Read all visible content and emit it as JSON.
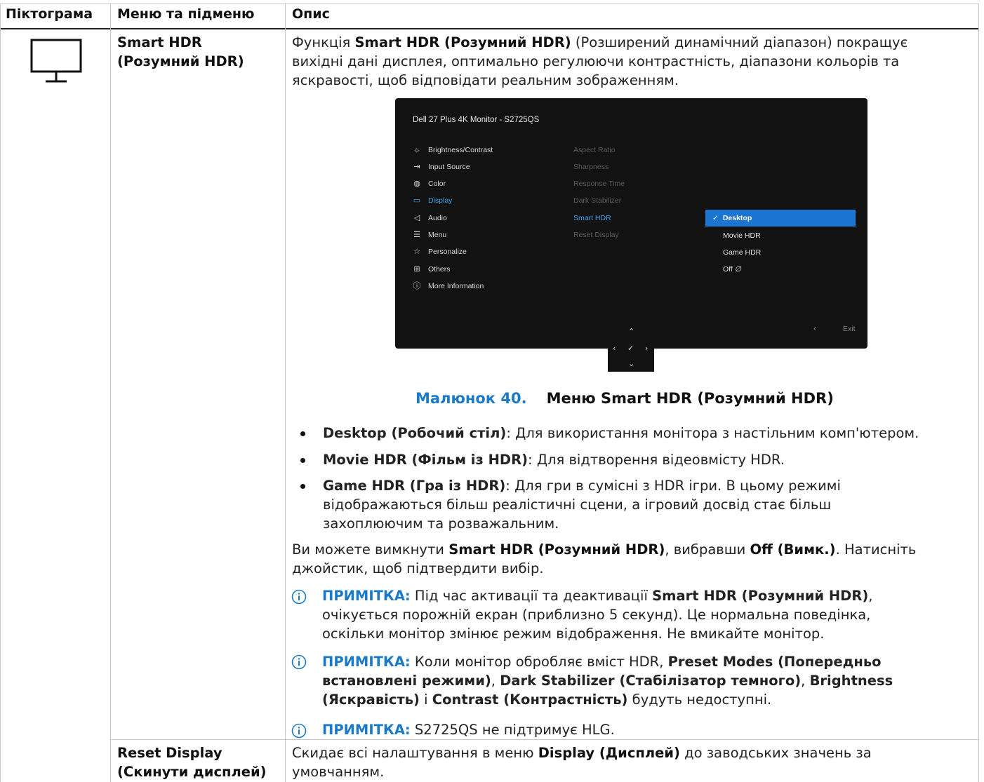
{
  "header": {
    "col_icon": "Піктограма",
    "col_menu": "Меню та підменю",
    "col_desc": "Опис"
  },
  "row1": {
    "menu_title_line1": "Smart HDR",
    "menu_title_line2": "(Розумний HDR)",
    "intro": {
      "l1_pre": "Функція ",
      "l1_bold": "Smart HDR (Розумний HDR)",
      "l1_post": " (Розширений динамічний діапазон) покращує",
      "l2": "вихідні дані дисплея, оптимально регулюючи контрастність, діапазони кольорів та",
      "l3": "яскравості, щоб відповідати реальним зображенням."
    },
    "osd": {
      "title": "Dell 27 Plus 4K Monitor - S2725QS",
      "menu_items": [
        {
          "label": "Brightness/Contrast",
          "icon": "sun-icon"
        },
        {
          "label": "Input Source",
          "icon": "input-icon"
        },
        {
          "label": "Color",
          "icon": "palette-icon"
        },
        {
          "label": "Display",
          "icon": "monitor-icon"
        },
        {
          "label": "Audio",
          "icon": "speaker-icon"
        },
        {
          "label": "Menu",
          "icon": "menu-icon"
        },
        {
          "label": "Personalize",
          "icon": "star-icon"
        },
        {
          "label": "Others",
          "icon": "others-icon"
        },
        {
          "label": "More Information",
          "icon": "info-icon"
        }
      ],
      "sub_items": [
        "Aspect Ratio",
        "Sharpness",
        "Response Time",
        "Dark Stabilizer",
        "Smart HDR",
        "Reset Display"
      ],
      "options": [
        "Desktop",
        "Movie HDR",
        "Game HDR",
        "Off"
      ],
      "exit_label": "Exit",
      "accent": "#1b74cf"
    },
    "caption": {
      "number": "Малюнок 40.",
      "text": "Меню Smart HDR (Розумний HDR)"
    },
    "bullets": [
      {
        "bold": "Desktop (Робочий стіл)",
        "text": ": Для використання монітора з настільним комп'ютером."
      },
      {
        "bold": "Movie HDR (Фільм із HDR)",
        "text": ": Для відтворення відеовмісту HDR."
      },
      {
        "bold": "Game HDR (Гра із HDR)",
        "text": ": Для гри в сумісні з HDR ігри. В цьому режимі",
        "l2": "відображаються більш реалістичні сцени, а ігровий досвід стає більш",
        "l3": "захоплюючим та розважальним."
      }
    ],
    "off_para": {
      "pre": "Ви можете вимкнути ",
      "b1": "Smart HDR (Розумний HDR)",
      "mid": ", вибравши ",
      "b2": "Off (Вимк.)",
      "post": ". Натисніть",
      "l2": "джойстик, щоб підтвердити вибір."
    },
    "notes": [
      {
        "label": "ПРИМІТКА:",
        "pre": " Під час активації та деактивації ",
        "bold": "Smart HDR (Розумний HDR)",
        "post": ",",
        "l2": "очікується порожній екран (приблизно 5 секунд). Це нормальна поведінка,",
        "l3": "оскільки монітор змінює режим відображення. Не вмикайте монітор."
      },
      {
        "label": "ПРИМІТКА:",
        "pre": " Коли монітор обробляє вміст HDR, ",
        "b1": "Preset Modes (Попередньо",
        "b1b": "встановлені режими)",
        "c1": ", ",
        "b2": "Dark Stabilizer (Стабілізатор темного)",
        "c2": ", ",
        "b3": "Brightness",
        "b3b": "(Яскравість)",
        "c3": " і ",
        "b4": "Contrast (Контрастність)",
        "post": " будуть недоступні."
      },
      {
        "label": "ПРИМІТКА:",
        "text": " S2725QS не підтримує HLG."
      }
    ]
  },
  "row2": {
    "menu_title_line1": "Reset Display",
    "menu_title_line2": "(Скинути дисплей)",
    "pre": "Скидає всі налаштування в меню ",
    "bold": "Display (Дисплей)",
    "post": " до заводських значень за",
    "l2": "умовчанням."
  }
}
